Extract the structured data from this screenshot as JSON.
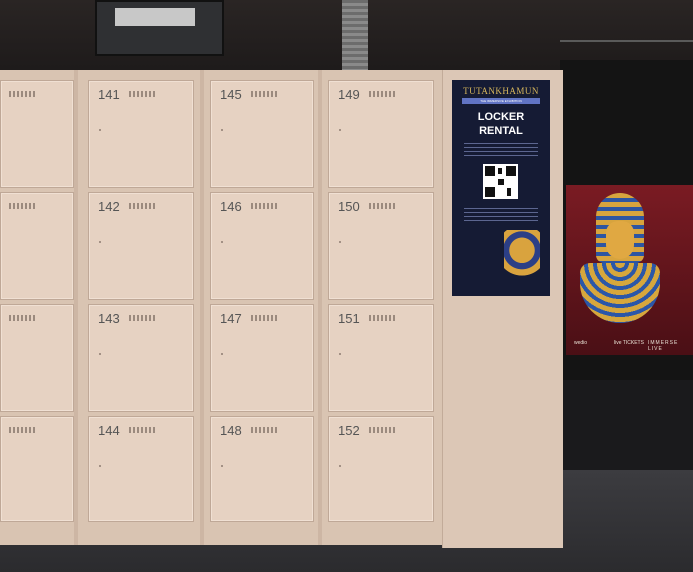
{
  "lockers": {
    "column_1": [
      "141",
      "142",
      "143",
      "144"
    ],
    "column_2": [
      "145",
      "146",
      "147",
      "148"
    ],
    "column_3": [
      "149",
      "150",
      "151",
      "152"
    ]
  },
  "kiosk": {
    "brand": "TUTANKHAMUN",
    "subtitle": "THE IMMERSIVE EXHIBITION",
    "title_line_1": "LOCKER",
    "title_line_2": "RENTAL"
  },
  "poster": {
    "sponsor_1": "wedio",
    "sponsor_2": "live TICKETS",
    "sponsor_3": "IMMERSE LIVE"
  }
}
